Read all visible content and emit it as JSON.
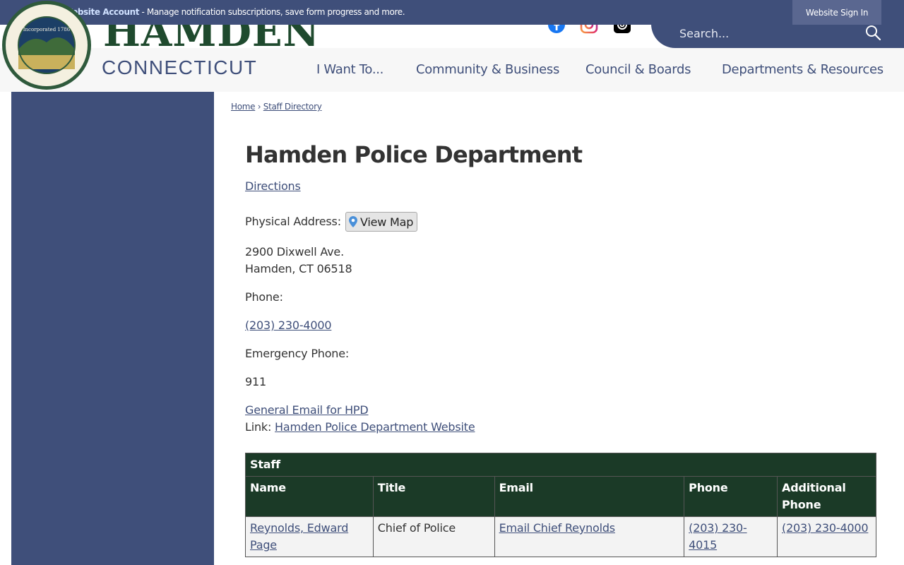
{
  "notification": {
    "link": "Create a Website Account",
    "text": " - Manage notification subscriptions, save form progress and more."
  },
  "signin_label": "Website Sign In",
  "logo": {
    "name": "HAMDEN",
    "state": "CONNECTICUT",
    "seal_year": "Incorporated 1786"
  },
  "social": [
    "facebook-icon",
    "instagram-icon",
    "threads-icon"
  ],
  "search": {
    "placeholder": "Search..."
  },
  "nav": [
    "I Want To...",
    "Community & Business",
    "Council & Boards",
    "Departments & Resources"
  ],
  "breadcrumb": {
    "home": "Home",
    "sep": "›",
    "current": "Staff Directory"
  },
  "department": {
    "title": "Hamden Police Department",
    "directions": "Directions",
    "physical_address_label": "Physical Address:",
    "view_map": "View Map",
    "address_line1": "2900 Dixwell Ave.",
    "address_line2": "Hamden, CT 06518",
    "phone_label": "Phone:",
    "phone": "(203) 230-4000",
    "emergency_label": "Emergency Phone:",
    "emergency": "911",
    "general_email": "General Email for HPD",
    "link_label": "Link: ",
    "link_text": "Hamden Police Department Website"
  },
  "staff": {
    "caption": "Staff",
    "headers": [
      "Name",
      "Title",
      "Email",
      "Phone",
      "Additional Phone"
    ],
    "rows": [
      {
        "name": "Reynolds, Edward Page",
        "title": "Chief of Police",
        "email": "Email Chief Reynolds",
        "phone": "(203) 230-4015",
        "additional_phone": "(203) 230-4000"
      }
    ]
  },
  "colors": {
    "brand_blue": "#3f4f7a",
    "brand_green": "#1b3a27",
    "logo_green": "#1f4a2e"
  }
}
